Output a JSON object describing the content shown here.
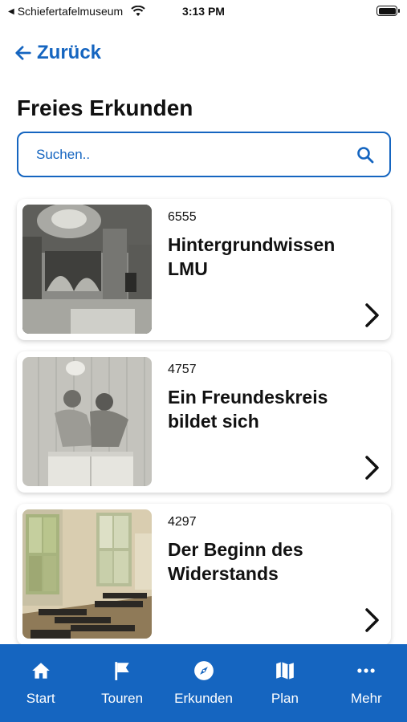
{
  "status_bar": {
    "back_app": "Schiefertafelmuseum",
    "time": "3:13 PM"
  },
  "nav": {
    "back_label": "Zurück"
  },
  "page": {
    "title": "Freies Erkunden"
  },
  "search": {
    "placeholder": "Suchen.."
  },
  "cards": [
    {
      "id": "6555",
      "title": "Hintergrundwissen LMU",
      "image": "historic-university-hall-photo"
    },
    {
      "id": "4757",
      "title": "Ein Freundeskreis bildet sich",
      "image": "two-men-sitting-on-table-photo"
    },
    {
      "id": "4297",
      "title": "Der Beginn des Widerstands",
      "image": "empty-lecture-hall-photo"
    }
  ],
  "tab_bar": {
    "items": [
      {
        "label": "Start",
        "icon": "home-icon"
      },
      {
        "label": "Touren",
        "icon": "flag-icon"
      },
      {
        "label": "Erkunden",
        "icon": "compass-icon"
      },
      {
        "label": "Plan",
        "icon": "map-icon"
      },
      {
        "label": "Mehr",
        "icon": "more-icon"
      }
    ]
  },
  "colors": {
    "accent": "#1565c0",
    "background": "#ffffff",
    "text": "#111111"
  }
}
